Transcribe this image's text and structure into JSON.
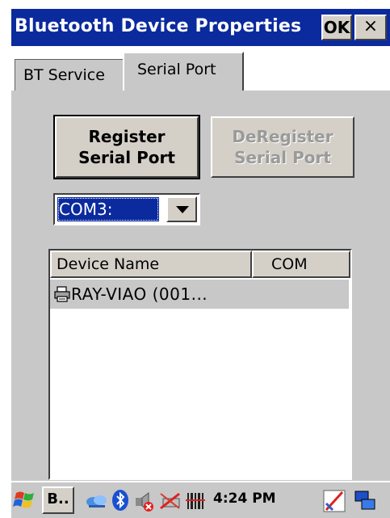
{
  "window": {
    "title": "Bluetooth Device Properties",
    "ok_label": "OK",
    "close_label": "×"
  },
  "tabs": [
    {
      "label": "BT Service",
      "active": false
    },
    {
      "label": "Serial Port",
      "active": true
    }
  ],
  "buttons": {
    "register_line1": "Register",
    "register_line2": "Serial Port",
    "deregister_line1": "DeRegister",
    "deregister_line2": "Serial Port",
    "deregister_enabled": false
  },
  "com_select": {
    "value": "COM3:"
  },
  "device_list": {
    "columns": [
      "Device Name",
      "COM"
    ],
    "rows": [
      {
        "name": "RAY-VIAO (001...",
        "com": "",
        "icon": "printer-icon"
      }
    ]
  },
  "taskbar": {
    "task_label": "B..",
    "time": "4:24 PM",
    "icons": [
      "start-flag-icon",
      "network-icon",
      "bluetooth-icon",
      "volume-icon",
      "battery-icon",
      "signal-icon",
      "input-panel-icon",
      "desktop-icon"
    ]
  },
  "colors": {
    "titlebar": "#0a2a9e",
    "selection": "#0a2a9e",
    "face": "#d4d0c8"
  }
}
